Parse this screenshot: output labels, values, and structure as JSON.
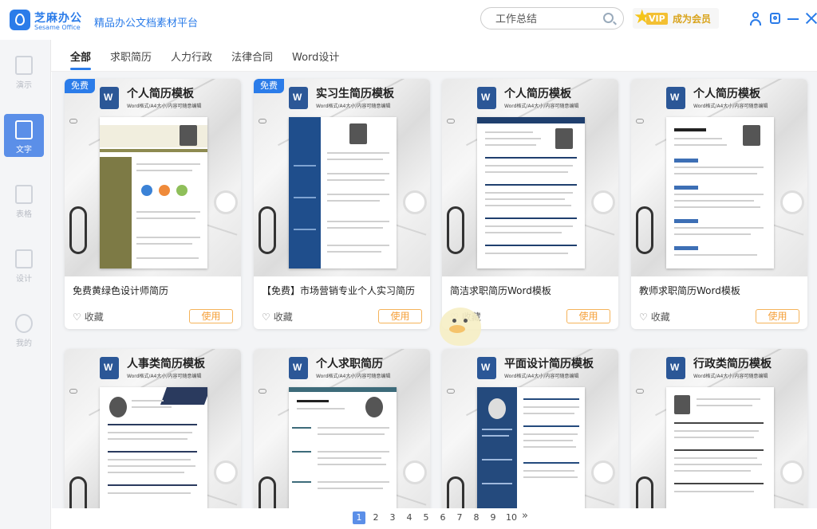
{
  "app": {
    "name_cn": "芝麻办公",
    "name_en": "Sesame Office",
    "slogan": "精品办公文档素材平台"
  },
  "search": {
    "value": "工作总结"
  },
  "vip": {
    "tag": "VIP",
    "label": "成为会员"
  },
  "sidebar": {
    "items": [
      {
        "label": "演示"
      },
      {
        "label": "文字"
      },
      {
        "label": "表格"
      },
      {
        "label": "设计"
      },
      {
        "label": "我的"
      }
    ]
  },
  "tabs": [
    {
      "label": "全部"
    },
    {
      "label": "求职简历"
    },
    {
      "label": "人力行政"
    },
    {
      "label": "法律合同"
    },
    {
      "label": "Word设计"
    }
  ],
  "common": {
    "fav_label": "收藏",
    "use_label": "使用",
    "sub_caption": "Word格式/A4大小/内容可随意编辑",
    "free_badge": "免费"
  },
  "cards": [
    {
      "tpl_title": "个人简历模板",
      "title": "免费黄绿色设计师简历",
      "free": true
    },
    {
      "tpl_title": "实习生简历模板",
      "title": "【免费】市场营销专业个人实习简历",
      "free": true
    },
    {
      "tpl_title": "个人简历模板",
      "title": "简洁求职简历Word模板",
      "free": false
    },
    {
      "tpl_title": "个人简历模板",
      "title": "教师求职简历Word模板",
      "free": false
    },
    {
      "tpl_title": "人事类简历模板"
    },
    {
      "tpl_title": "个人求职简历"
    },
    {
      "tpl_title": "平面设计简历模板"
    },
    {
      "tpl_title": "行政类简历模板"
    }
  ],
  "pagination": {
    "pages": [
      "1",
      "2",
      "3",
      "4",
      "5",
      "6",
      "7",
      "8",
      "9",
      "10"
    ],
    "current": "1",
    "next": "»"
  },
  "colors": {
    "brand": "#2b7ce9",
    "use_button": "#f5a03a",
    "vip_gold": "#f3c033"
  },
  "icons": [
    "user-icon",
    "settings-icon",
    "minimize-icon",
    "close-icon",
    "search-icon",
    "crown-icon",
    "word-icon",
    "heart-icon"
  ]
}
